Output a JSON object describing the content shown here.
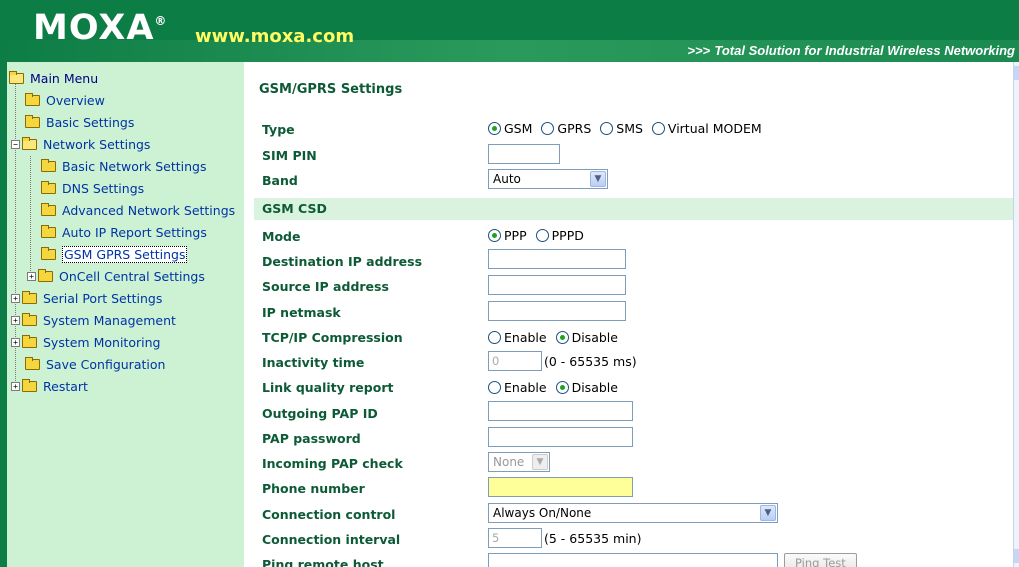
{
  "header": {
    "logo": "MOXA",
    "logo_mark": "®",
    "url": "www.moxa.com",
    "tagline": "Total Solution for Industrial Wireless Networking",
    "tagline_prefix": ">>>"
  },
  "sidebar": {
    "items": [
      {
        "label": "Main Menu",
        "icon": "folder-open-icon"
      },
      {
        "label": "Overview",
        "icon": "folder-icon"
      },
      {
        "label": "Basic Settings",
        "icon": "folder-icon"
      },
      {
        "label": "Network Settings",
        "icon": "folder-open-icon",
        "expander": "−"
      },
      {
        "label": "Basic Network Settings",
        "icon": "folder-icon"
      },
      {
        "label": "DNS Settings",
        "icon": "folder-icon"
      },
      {
        "label": "Advanced Network Settings",
        "icon": "folder-icon"
      },
      {
        "label": "Auto IP Report Settings",
        "icon": "folder-icon"
      },
      {
        "label": "GSM GPRS Settings",
        "icon": "folder-icon",
        "selected": true
      },
      {
        "label": "OnCell Central Settings",
        "icon": "folder-icon",
        "expander": "+"
      },
      {
        "label": "Serial Port Settings",
        "icon": "folder-icon",
        "expander": "+"
      },
      {
        "label": "System Management",
        "icon": "folder-icon",
        "expander": "+"
      },
      {
        "label": "System Monitoring",
        "icon": "folder-icon",
        "expander": "+"
      },
      {
        "label": "Save Configuration",
        "icon": "folder-icon"
      },
      {
        "label": "Restart",
        "icon": "folder-icon",
        "expander": "+"
      }
    ]
  },
  "main": {
    "title": "GSM/GPRS Settings",
    "section_gsm_csd": "GSM CSD",
    "type": {
      "label": "Type",
      "options": [
        "GSM",
        "GPRS",
        "SMS",
        "Virtual MODEM"
      ],
      "selected": "GSM"
    },
    "sim_pin": {
      "label": "SIM PIN",
      "value": ""
    },
    "band": {
      "label": "Band",
      "value": "Auto"
    },
    "mode": {
      "label": "Mode",
      "options": [
        "PPP",
        "PPPD"
      ],
      "selected": "PPP"
    },
    "dest_ip": {
      "label": "Destination IP address",
      "value": ""
    },
    "source_ip": {
      "label": "Source IP address",
      "value": ""
    },
    "ip_netmask": {
      "label": "IP netmask",
      "value": ""
    },
    "tcpip_compression": {
      "label": "TCP/IP Compression",
      "options": [
        "Enable",
        "Disable"
      ],
      "selected": "Disable"
    },
    "inactivity_time": {
      "label": "Inactivity time",
      "value": "0",
      "range": "(0 - 65535 ms)"
    },
    "link_quality": {
      "label": "Link quality report",
      "options": [
        "Enable",
        "Disable"
      ],
      "selected": "Disable"
    },
    "outgoing_pap_id": {
      "label": "Outgoing PAP ID",
      "value": ""
    },
    "pap_password": {
      "label": "PAP password",
      "value": ""
    },
    "incoming_pap": {
      "label": "Incoming PAP check",
      "value": "None"
    },
    "phone_number": {
      "label": "Phone number",
      "value": ""
    },
    "connection_control": {
      "label": "Connection control",
      "value": "Always On/None"
    },
    "connection_interval": {
      "label": "Connection interval",
      "value": "5",
      "range": "(5 - 65535 min)"
    },
    "ping_remote_host": {
      "label": "Ping remote host",
      "value": "",
      "button": "Ping Test"
    }
  },
  "colors": {
    "header_green": "#0d7d46",
    "sidebar_bg": "#ccf2d3",
    "label_green": "#0d5a36",
    "link_blue": "#0033a6",
    "url_yellow": "#fffb63"
  }
}
